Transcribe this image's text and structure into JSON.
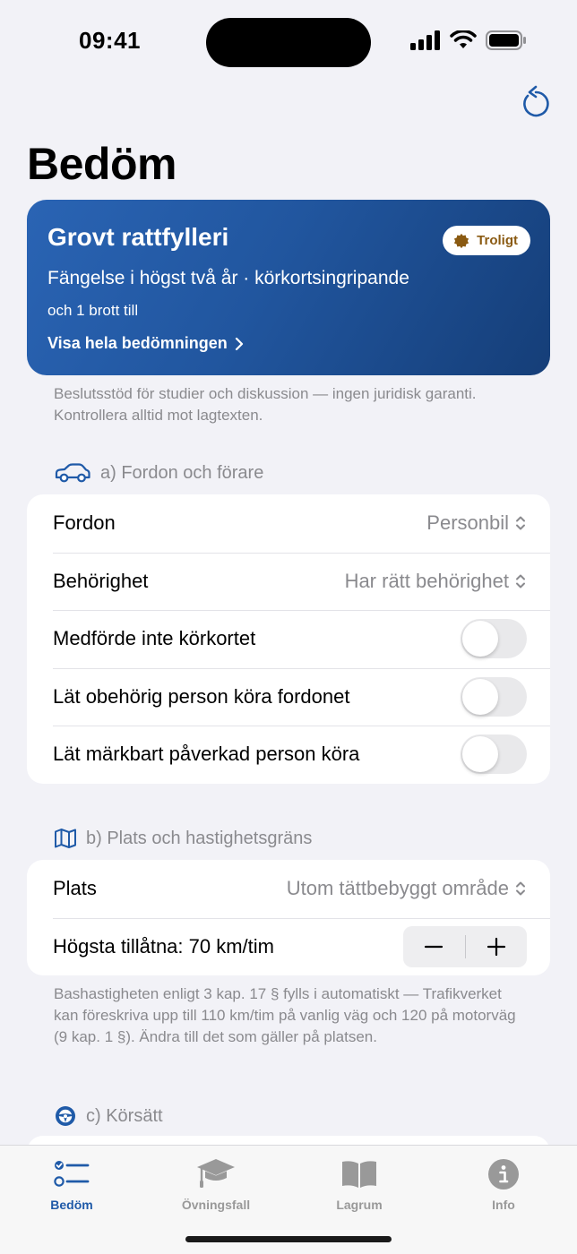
{
  "status_bar": {
    "time": "09:41"
  },
  "page": {
    "title": "Bedöm"
  },
  "hero": {
    "title": "Grovt rattfylleri",
    "badge": "Troligt",
    "subtitle": "Fängelse i högst två år · körkortsingripande",
    "extra": "och 1 brott till",
    "link": "Visa hela bedömningen"
  },
  "disclaimer": "Beslutsstöd för studier och diskussion — ingen juridisk garanti. Kontrollera alltid mot lagtexten.",
  "section_a": {
    "header": "a)  Fordon och förare",
    "rows": [
      {
        "label": "Fordon",
        "value": "Personbil"
      },
      {
        "label": "Behörighet",
        "value": "Har rätt behörighet"
      },
      {
        "label": "Medförde inte körkortet",
        "toggle": false
      },
      {
        "label": "Lät obehörig person köra fordonet",
        "toggle": false
      },
      {
        "label": "Lät märkbart påverkad person köra",
        "toggle": false
      }
    ]
  },
  "section_b": {
    "header": "b)  Plats och hastighetsgräns",
    "rows": [
      {
        "label": "Plats",
        "value": "Utom tättbebyggt område"
      },
      {
        "label": "Högsta tillåtna: 70 km/tim"
      }
    ],
    "footnote": "Bashastigheten enligt 3 kap. 17 § fylls i automatiskt — Trafikverket kan föreskriva upp till 110 km/tim på vanlig väg och 120 på motorväg (9 kap. 1 §). Ändra till det som gäller på platsen."
  },
  "section_c": {
    "header": "c)  Körsätt"
  },
  "tab_bar": {
    "tabs": [
      {
        "label": "Bedöm",
        "icon": "checklist-icon",
        "active": true
      },
      {
        "label": "Övningsfall",
        "icon": "graduation-cap-icon",
        "active": false
      },
      {
        "label": "Lagrum",
        "icon": "book-icon",
        "active": false
      },
      {
        "label": "Info",
        "icon": "info-icon",
        "active": false
      }
    ]
  },
  "colors": {
    "accent": "#1f5aa8",
    "hero_start": "#2a64b4",
    "hero_end": "#153e78",
    "badge_text": "#8a5a12"
  }
}
